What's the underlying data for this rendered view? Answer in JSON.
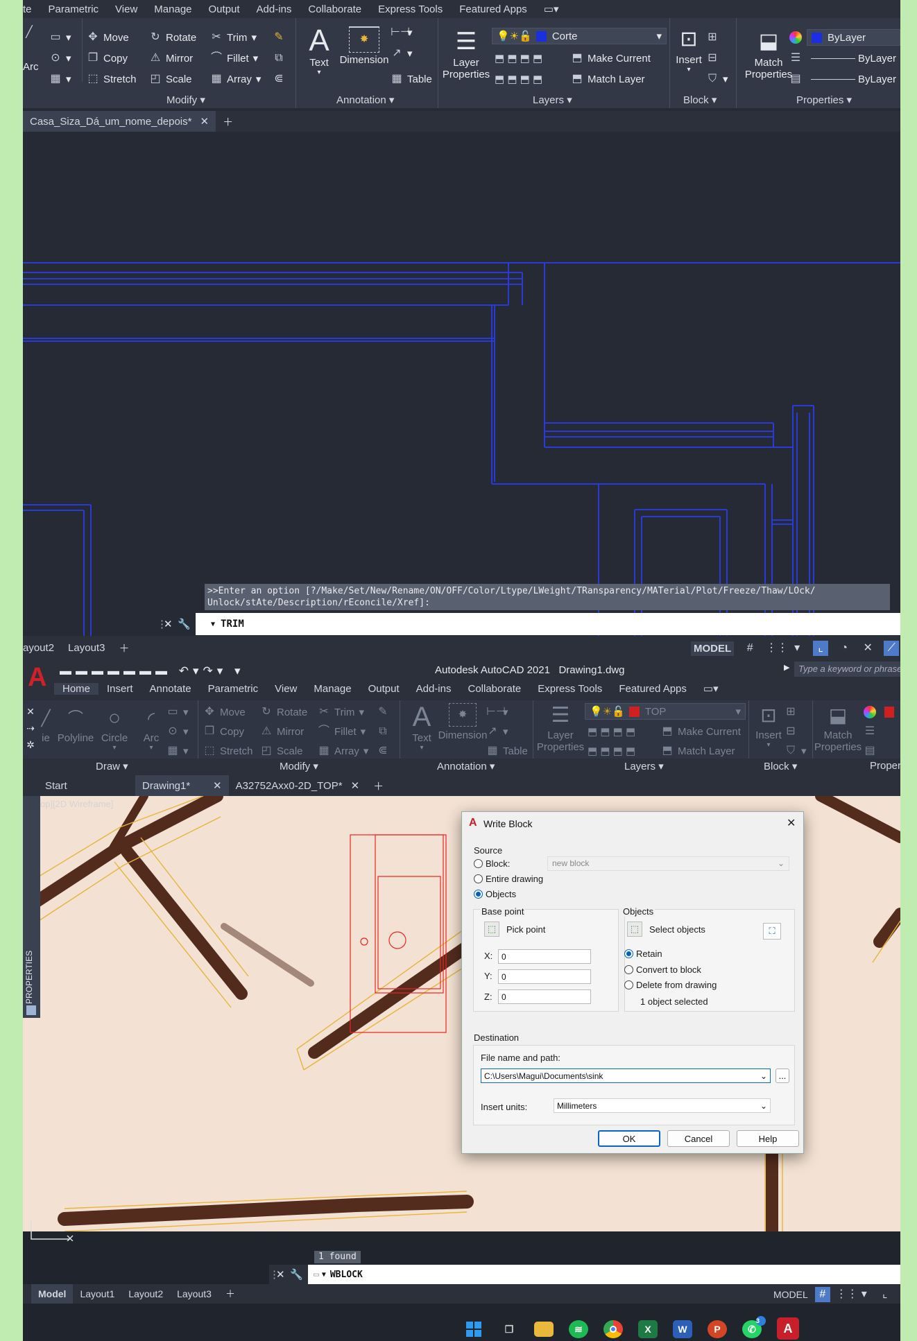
{
  "top": {
    "menu": [
      "te",
      "Parametric",
      "View",
      "Manage",
      "Output",
      "Add-ins",
      "Collaborate",
      "Express Tools",
      "Featured Apps"
    ],
    "modify": {
      "move": "Move",
      "rotate": "Rotate",
      "trim": "Trim",
      "copy": "Copy",
      "mirror": "Mirror",
      "fillet": "Fillet",
      "stretch": "Stretch",
      "scale": "Scale",
      "array": "Array",
      "label": "Modify"
    },
    "arc_label": "Arc",
    "annotation": {
      "text": "Text",
      "dimension": "Dimension",
      "table": "Table",
      "label": "Annotation"
    },
    "layers": {
      "layer_name": "Corte",
      "layer_color": "#1a2fe0",
      "make_current": "Make Current",
      "match_layer": "Match Layer",
      "layer": "Layer",
      "properties": "Properties",
      "label": "Layers"
    },
    "block": {
      "insert": "Insert",
      "label": "Block"
    },
    "props": {
      "match": "Match",
      "properties": "Properties",
      "color": "ByLayer",
      "linetype": "ByLayer",
      "lineweight": "ByLayer",
      "label": "Properties"
    },
    "doc_tab": "Casa_Siza_Dá_um_nome_depois*",
    "cmd_prompt_line1": ">>Enter an option [?/Make/Set/New/Rename/ON/OFF/Color/Ltype/LWeight/TRansparency/MATerial/Plot/Freeze/Thaw/LOck/",
    "cmd_prompt_line2": "Unlock/stAte/Description/rEconcile/Xref]:",
    "cmd_input": "TRIM",
    "layout_tabs": [
      "ayout2",
      "Layout3"
    ],
    "model": "MODEL"
  },
  "bot": {
    "title": "Autodesk AutoCAD 2021",
    "doc": "Drawing1.dwg",
    "search_placeholder": "Type a keyword or phrase",
    "menu": [
      "Home",
      "Insert",
      "Annotate",
      "Parametric",
      "View",
      "Manage",
      "Output",
      "Add-ins",
      "Collaborate",
      "Express Tools",
      "Featured Apps"
    ],
    "draw": {
      "line": "ie",
      "polyline": "Polyline",
      "circle": "Circle",
      "arc": "Arc",
      "label": "Draw"
    },
    "modify": {
      "move": "Move",
      "rotate": "Rotate",
      "trim": "Trim",
      "copy": "Copy",
      "mirror": "Mirror",
      "fillet": "Fillet",
      "stretch": "Stretch",
      "scale": "Scale",
      "array": "Array",
      "label": "Modify"
    },
    "annotation": {
      "text": "Text",
      "dimension": "Dimension",
      "table": "Table",
      "label": "Annotation"
    },
    "layers": {
      "layer_name": "TOP",
      "layer_color": "#d22020",
      "make_current": "Make Current",
      "match_layer": "Match Layer",
      "layer": "Layer",
      "properties": "Properties",
      "label": "Layers"
    },
    "block": {
      "insert": "Insert",
      "label": "Block"
    },
    "props": {
      "match": "Match",
      "properties": "Properties",
      "label": "Propert"
    },
    "tabs": [
      "Start",
      "Drawing1*",
      "A32752Axx0-2D_TOP*"
    ],
    "viewport": "op][2D Wireframe]",
    "palette": "PROPERTIES",
    "found": "1 found",
    "cmd_input": "WBLOCK",
    "layout_tabs": [
      "Model",
      "Layout1",
      "Layout2",
      "Layout3"
    ],
    "model": "MODEL"
  },
  "dialog": {
    "title": "Write Block",
    "source": "Source",
    "block": "Block:",
    "block_value": "new block",
    "entire": "Entire drawing",
    "objects": "Objects",
    "base_point": "Base point",
    "pick_point": "Pick point",
    "x": "X:",
    "y": "Y:",
    "z": "Z:",
    "x_val": "0",
    "y_val": "0",
    "z_val": "0",
    "objects_group": "Objects",
    "select_objects": "Select objects",
    "retain": "Retain",
    "convert": "Convert to block",
    "delete": "Delete from drawing",
    "selected": "1 object selected",
    "destination": "Destination",
    "file_label": "File name and path:",
    "file_value": "C:\\Users\\Magui\\Documents\\sink",
    "browse": "...",
    "units_label": "Insert units:",
    "units_value": "Millimeters",
    "ok": "OK",
    "cancel": "Cancel",
    "help": "Help"
  },
  "taskbar": {
    "whatsapp_badge": "3"
  }
}
